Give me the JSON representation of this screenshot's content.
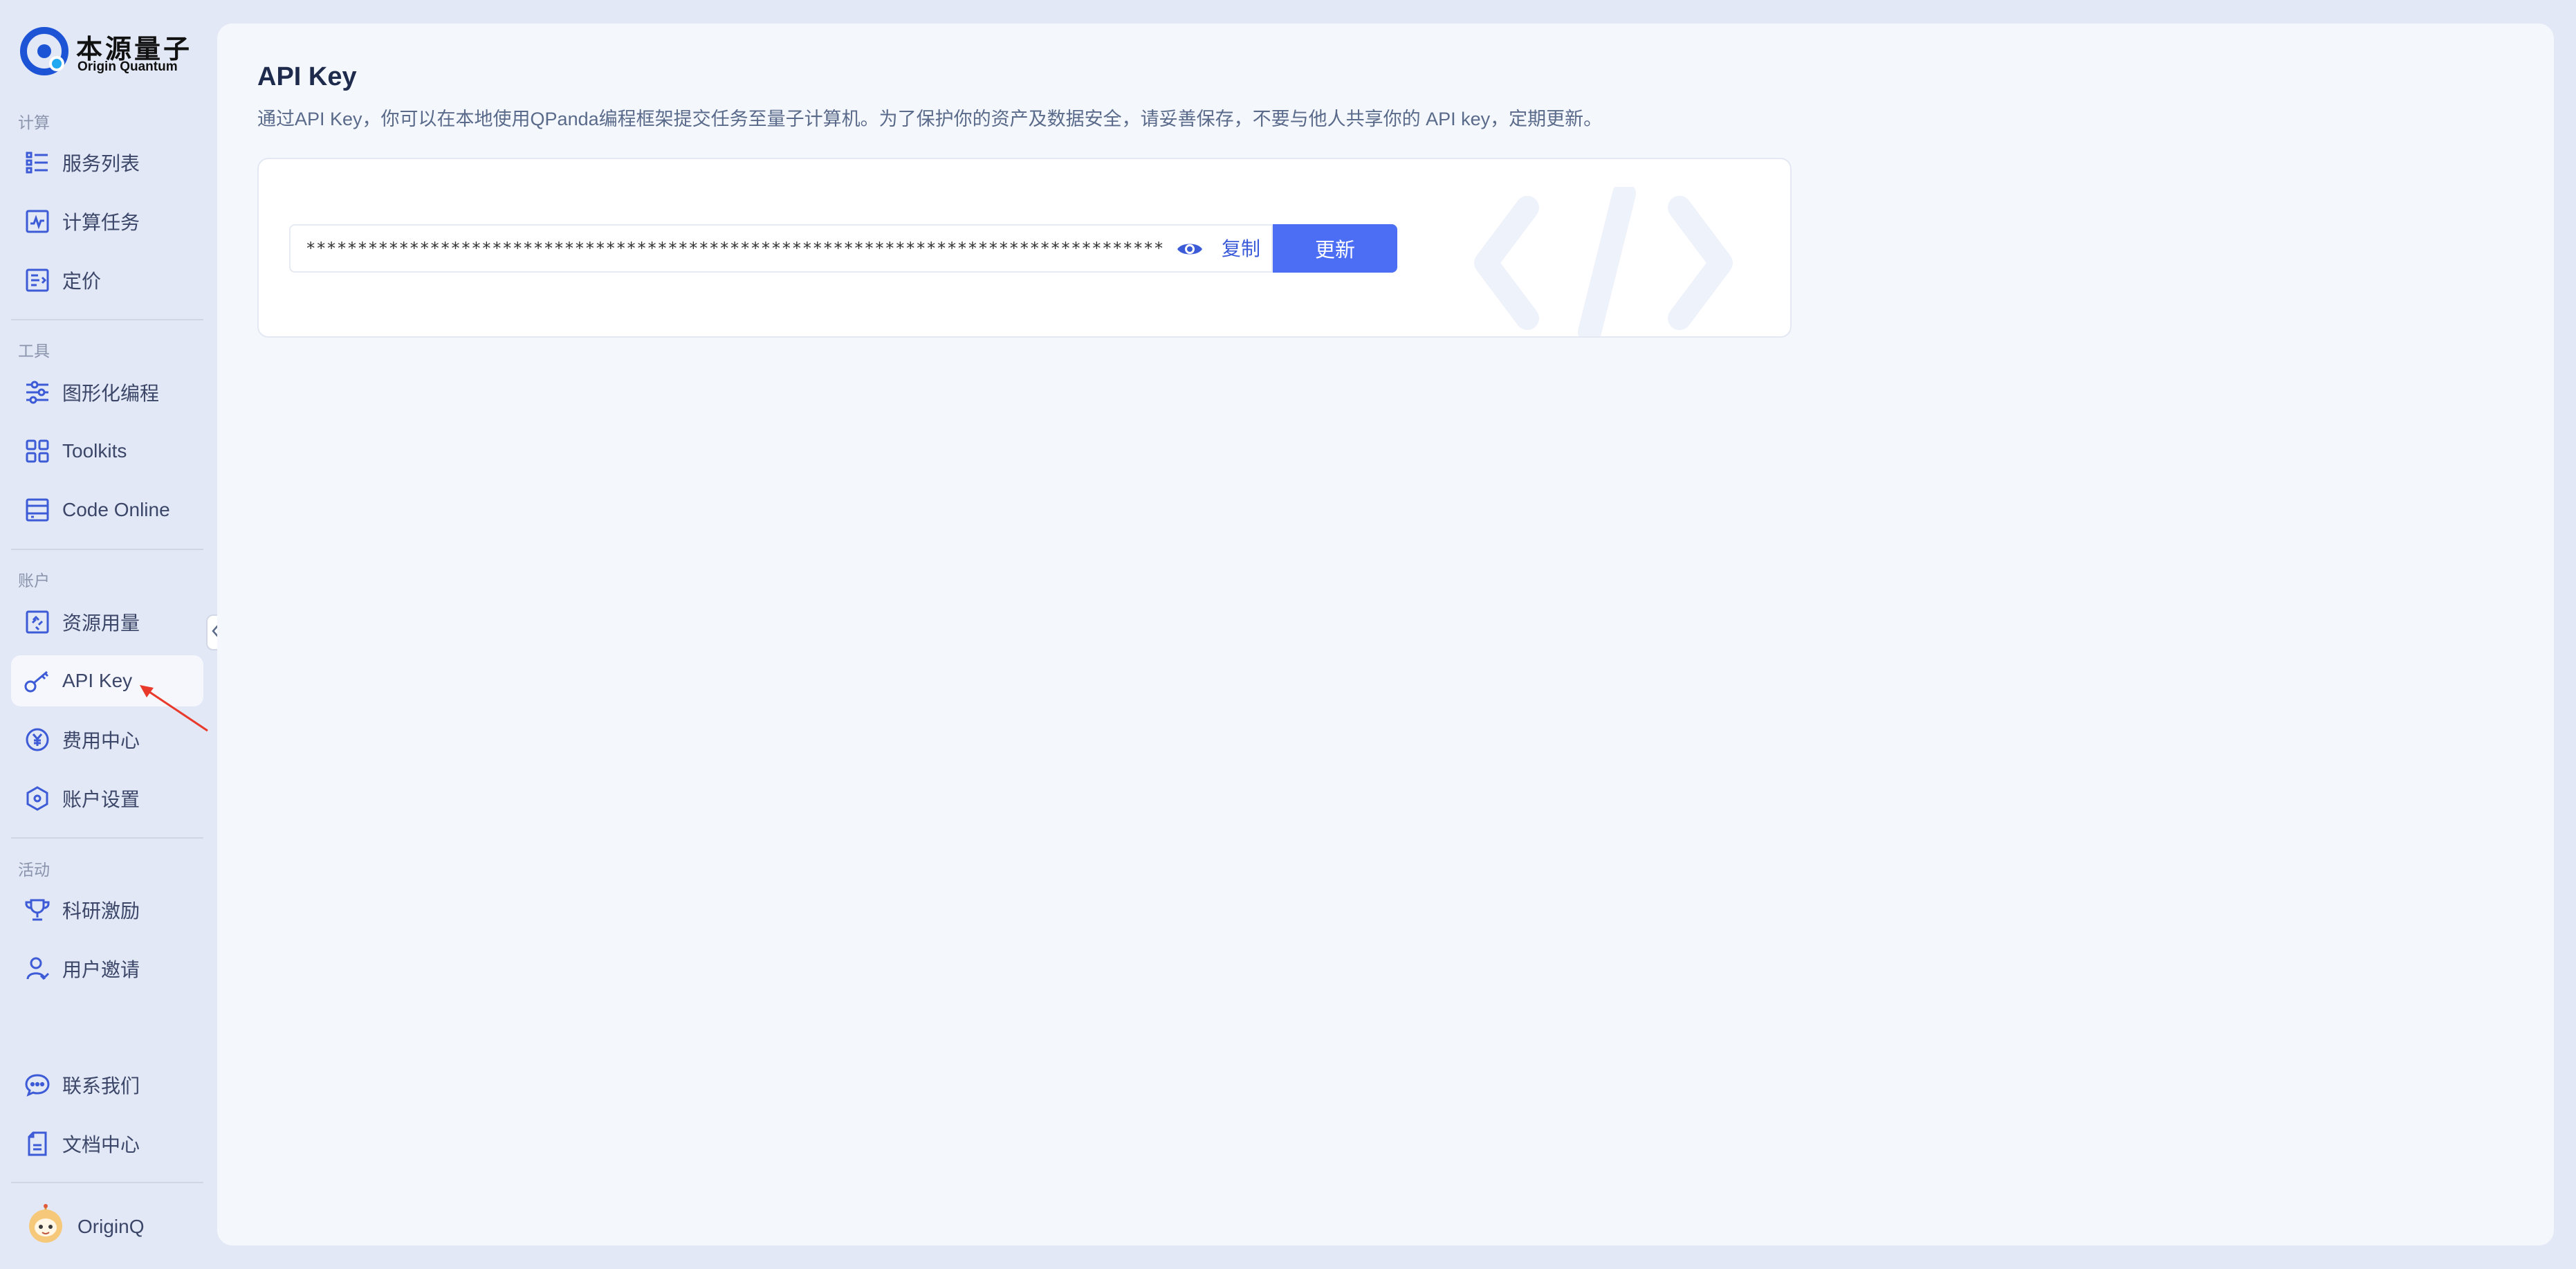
{
  "brand": {
    "name_cn": "本源量子",
    "name_en": "Origin Quantum"
  },
  "sidebar": {
    "sections": [
      {
        "label": "计算",
        "items": [
          {
            "label": "服务列表",
            "icon": "list-icon"
          },
          {
            "label": "计算任务",
            "icon": "pulse-chart-icon"
          },
          {
            "label": "定价",
            "icon": "price-tag-icon"
          }
        ]
      },
      {
        "label": "工具",
        "items": [
          {
            "label": "图形化编程",
            "icon": "sliders-icon"
          },
          {
            "label": "Toolkits",
            "icon": "grid-icon"
          },
          {
            "label": "Code Online",
            "icon": "code-window-icon"
          }
        ]
      },
      {
        "label": "账户",
        "items": [
          {
            "label": "资源用量",
            "icon": "resource-icon"
          },
          {
            "label": "API Key",
            "icon": "key-icon",
            "active": true
          },
          {
            "label": "费用中心",
            "icon": "yen-icon"
          },
          {
            "label": "账户设置",
            "icon": "settings-hex-icon"
          }
        ]
      },
      {
        "label": "活动",
        "items": [
          {
            "label": "科研激励",
            "icon": "trophy-icon"
          },
          {
            "label": "用户邀请",
            "icon": "user-invite-icon"
          }
        ]
      }
    ],
    "footer_items": [
      {
        "label": "联系我们",
        "icon": "chat-icon"
      },
      {
        "label": "文档中心",
        "icon": "document-icon"
      }
    ],
    "user": {
      "name": "OriginQ"
    }
  },
  "main": {
    "title": "API Key",
    "description": "通过API Key，你可以在本地使用QPanda编程框架提交任务至量子计算机。为了保护你的资产及数据安全，请妥善保存，不要与他人共享你的 API key，定期更新。",
    "key_field": {
      "value": "****************************************************************************************************************************************"
    },
    "copy_label": "复制",
    "update_label": "更新"
  },
  "colors": {
    "accent": "#4c6ef5",
    "link": "#3b5bd9",
    "icon": "#3d5bd6",
    "sidebar_bg": "#e2e8f5",
    "main_bg": "#f4f7fc",
    "annotation": "#e8392a"
  }
}
